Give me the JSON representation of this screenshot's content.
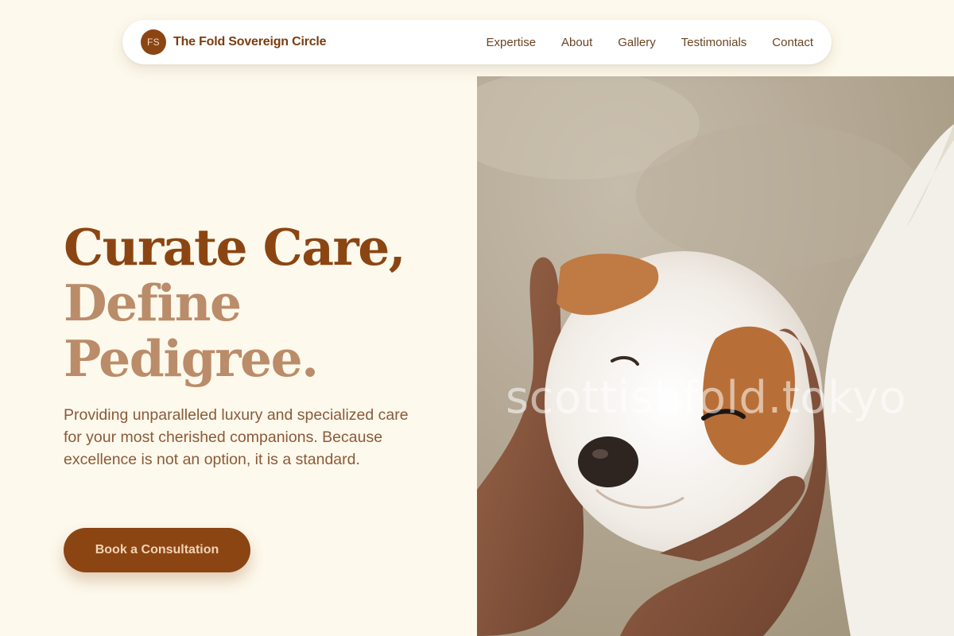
{
  "brand": {
    "logo_initials": "FS",
    "name": "The Fold Sovereign Circle",
    "accent_color": "#8b4513"
  },
  "nav": {
    "links": [
      {
        "label": "Expertise"
      },
      {
        "label": "About"
      },
      {
        "label": "Gallery"
      },
      {
        "label": "Testimonials"
      },
      {
        "label": "Contact"
      }
    ]
  },
  "hero": {
    "headline_line1": "Curate Care,",
    "headline_line2": "Define",
    "headline_line3": "Pedigree.",
    "subtitle": "Providing unparalleled luxury and specialized care for your most cherished companions. Because excellence is not an option, it is a standard.",
    "cta_label": "Book a Consultation"
  },
  "image": {
    "subject": "puppy-held-in-hands",
    "watermark": "scottishfold.tokyo"
  }
}
